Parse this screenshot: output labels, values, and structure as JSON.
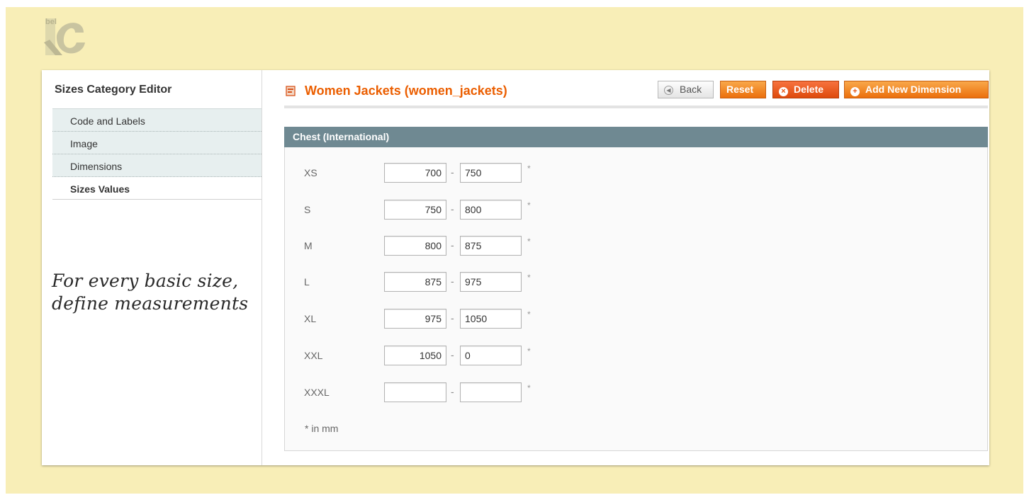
{
  "brand": {
    "logo_text": "bel",
    "logo_mark": "gc-logo"
  },
  "sidebar": {
    "title": "Sizes Category Editor",
    "items": [
      {
        "label": "Code and Labels",
        "active": false
      },
      {
        "label": "Image",
        "active": false
      },
      {
        "label": "Dimensions",
        "active": false
      },
      {
        "label": "Sizes Values",
        "active": true
      }
    ]
  },
  "annotation": {
    "line1": "For every basic size,",
    "line2": "define measurements"
  },
  "header": {
    "title": "Women Jackets (women_jackets)",
    "icon": "document-icon",
    "buttons": {
      "back": "Back",
      "reset": "Reset",
      "delete": "Delete",
      "add": "Add New Dimension"
    }
  },
  "section": {
    "title": "Chest (International)",
    "rows": [
      {
        "label": "XS",
        "from": "700",
        "to": "750"
      },
      {
        "label": "S",
        "from": "750",
        "to": "800"
      },
      {
        "label": "M",
        "from": "800",
        "to": "875"
      },
      {
        "label": "L",
        "from": "875",
        "to": "975"
      },
      {
        "label": "XL",
        "from": "975",
        "to": "1050"
      },
      {
        "label": "XXL",
        "from": "1050",
        "to": "0"
      },
      {
        "label": "XXXL",
        "from": "",
        "to": ""
      }
    ],
    "separator": "-",
    "required_mark": "*",
    "note": "* in mm"
  },
  "colors": {
    "background": "#f8eeb7",
    "accent": "#eb5e00",
    "section_header": "#6f8992",
    "sidebar_item": "#e7efef"
  }
}
